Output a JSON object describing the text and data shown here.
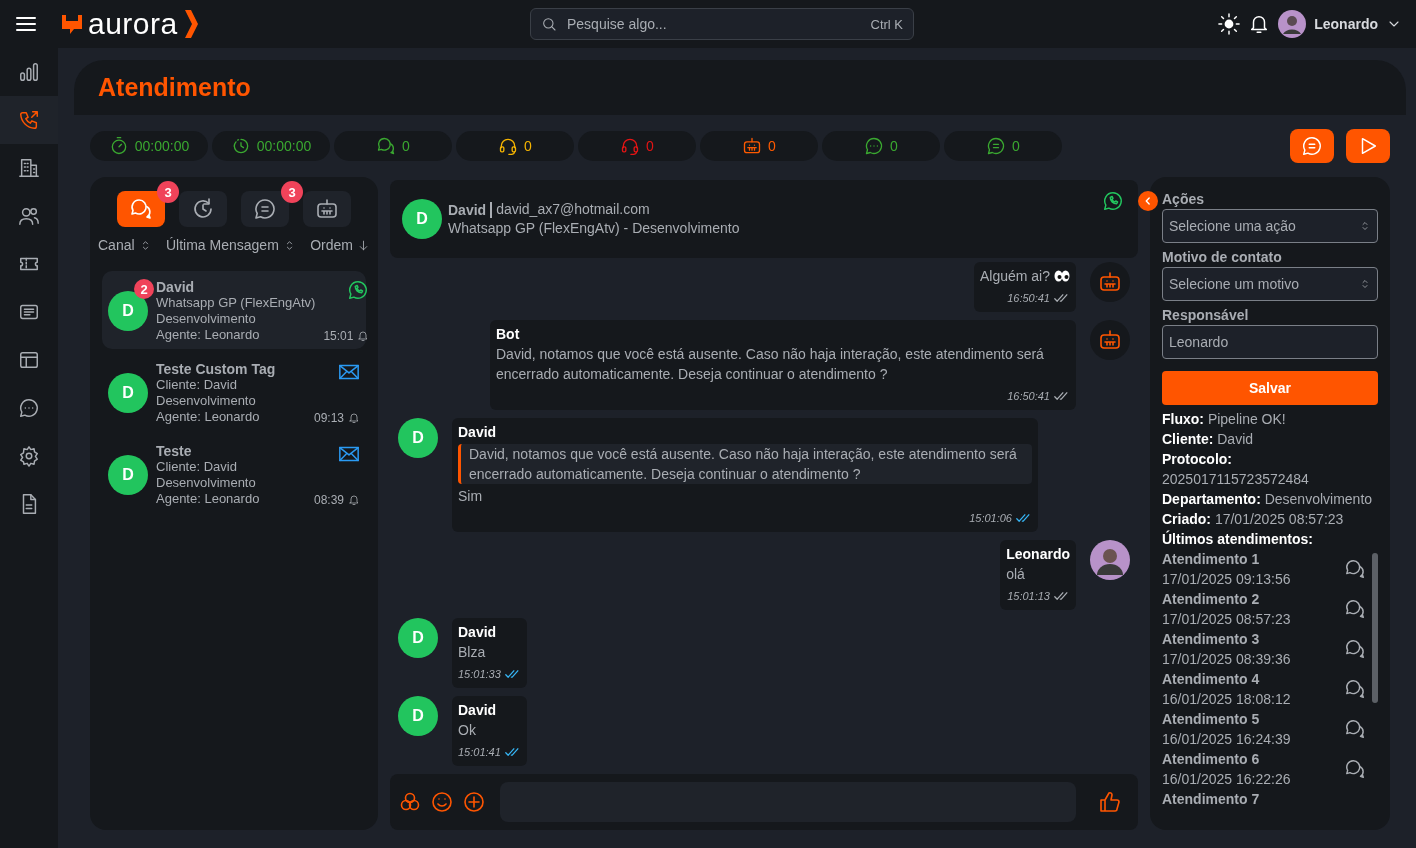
{
  "header": {
    "brand": "aurora",
    "search_placeholder": "Pesquise algo...",
    "shortcut": "Ctrl K",
    "user": "Leonardo"
  },
  "rail": [
    {
      "kind": "chart",
      "selected": false
    },
    {
      "kind": "phone",
      "selected": true
    },
    {
      "kind": "building",
      "selected": false
    },
    {
      "kind": "users",
      "selected": false
    },
    {
      "kind": "ticket",
      "selected": false
    },
    {
      "kind": "list",
      "selected": false
    },
    {
      "kind": "layout",
      "selected": false
    },
    {
      "kind": "chat-dots",
      "selected": false
    },
    {
      "kind": "gear",
      "selected": false
    },
    {
      "kind": "document",
      "selected": false
    }
  ],
  "page": {
    "title": "Atendimento"
  },
  "stats": [
    {
      "kind": "stopwatch",
      "value": "00:00:00",
      "color": "#3aa830"
    },
    {
      "kind": "clock",
      "value": "00:00:00",
      "color": "#3aa830"
    },
    {
      "kind": "chats",
      "value": "0",
      "color": "#3aa830"
    },
    {
      "kind": "headset",
      "value": "0",
      "color": "#f5b400"
    },
    {
      "kind": "headset",
      "value": "0",
      "color": "#e41414"
    },
    {
      "kind": "robot",
      "value": "0",
      "color": "#ff5a00"
    },
    {
      "kind": "chat-dots",
      "value": "0",
      "color": "#3aa830"
    },
    {
      "kind": "chat-lines",
      "value": "0",
      "color": "#3aa830"
    }
  ],
  "actions": [
    {
      "kind": "chat-lines"
    },
    {
      "kind": "play"
    }
  ],
  "queue": {
    "tabs": [
      {
        "kind": "chats",
        "selected": true,
        "badge": "3"
      },
      {
        "kind": "history",
        "selected": false
      },
      {
        "kind": "chat-lines",
        "selected": false,
        "badge": "3"
      },
      {
        "kind": "robot",
        "selected": false
      }
    ],
    "sort": [
      {
        "label": "Canal",
        "kind": "toggle"
      },
      {
        "label": "Última Mensagem",
        "kind": "toggle"
      },
      {
        "label": "Ordem",
        "kind": "desc"
      }
    ],
    "conversations": [
      {
        "initial": "D",
        "name": "David",
        "lines": [
          "Whatsapp GP (FlexEngAtv)",
          "Desenvolvimento",
          "Agente: Leonardo"
        ],
        "time": "15:01",
        "kind": "whatsapp",
        "selected": true,
        "badge": "2"
      },
      {
        "initial": "D",
        "name": "Teste Custom Tag",
        "lines": [
          "Cliente: David",
          "Desenvolvimento",
          "Agente: Leonardo"
        ],
        "time": "09:13",
        "kind": "email",
        "selected": false
      },
      {
        "initial": "D",
        "name": "Teste",
        "lines": [
          "Cliente: David",
          "Desenvolvimento",
          "Agente: Leonardo"
        ],
        "time": "08:39",
        "kind": "email",
        "selected": false
      }
    ]
  },
  "chat": {
    "contact": {
      "initial": "D",
      "name": "David",
      "email": "david_ax7@hotmail.com",
      "subtitle": "Whatsapp GP (FlexEngAtv) - Desenvolvimento",
      "kind": "whatsapp"
    },
    "messages": [
      {
        "kind": "bot",
        "text": "Alguém ai?",
        "time": "16:50:41",
        "read": false
      },
      {
        "kind": "bot",
        "sender": "Bot",
        "text": "David, notamos que você está ausente. Caso não haja interação, este atendimento será encerrado automaticamente. Deseja continuar o atendimento ?",
        "time": "16:50:41",
        "read": false
      },
      {
        "kind": "contact",
        "initial": "D",
        "sender": "David",
        "quote": "David, notamos que você está ausente. Caso não haja interação, este atendimento será encerrado automaticamente. Deseja continuar o atendimento ?",
        "text": "Sim",
        "time": "15:01:06",
        "read": true
      },
      {
        "kind": "agent",
        "sender": "Leonardo",
        "text": "olá",
        "time": "15:01:13",
        "read": false
      },
      {
        "kind": "contact",
        "initial": "D",
        "sender": "David",
        "text": "Blza",
        "time": "15:01:33",
        "read": true
      },
      {
        "kind": "contact",
        "initial": "D",
        "sender": "David",
        "text": "Ok",
        "time": "15:01:41",
        "read": true
      }
    ]
  },
  "details": {
    "fields": [
      {
        "label": "Ações",
        "kind": "select",
        "placeholder": "Selecione uma ação"
      },
      {
        "label": "Motivo de contato",
        "kind": "select",
        "placeholder": "Selecione um motivo"
      },
      {
        "label": "Responsável",
        "kind": "input",
        "value": "Leonardo"
      }
    ],
    "save": "Salvar",
    "info": [
      {
        "label": "Fluxo:",
        "value": "Pipeline OK!"
      },
      {
        "label": "Cliente:",
        "value": "David"
      },
      {
        "label": "Protocolo:",
        "value": "2025017115723572484"
      },
      {
        "label": "Departamento:",
        "value": "Desenvolvimento"
      },
      {
        "label": "Criado:",
        "value": "17/01/2025 08:57:23"
      }
    ],
    "history_title": "Últimos atendimentos:",
    "history": [
      {
        "title": "Atendimento 1",
        "date": "17/01/2025 09:13:56"
      },
      {
        "title": "Atendimento 2",
        "date": "17/01/2025 08:57:23"
      },
      {
        "title": "Atendimento 3",
        "date": "17/01/2025 08:39:36"
      },
      {
        "title": "Atendimento 4",
        "date": "16/01/2025 18:08:12"
      },
      {
        "title": "Atendimento 5",
        "date": "16/01/2025 16:24:39"
      },
      {
        "title": "Atendimento 6",
        "date": "16/01/2025 16:22:26"
      },
      {
        "title": "Atendimento 7"
      }
    ]
  }
}
